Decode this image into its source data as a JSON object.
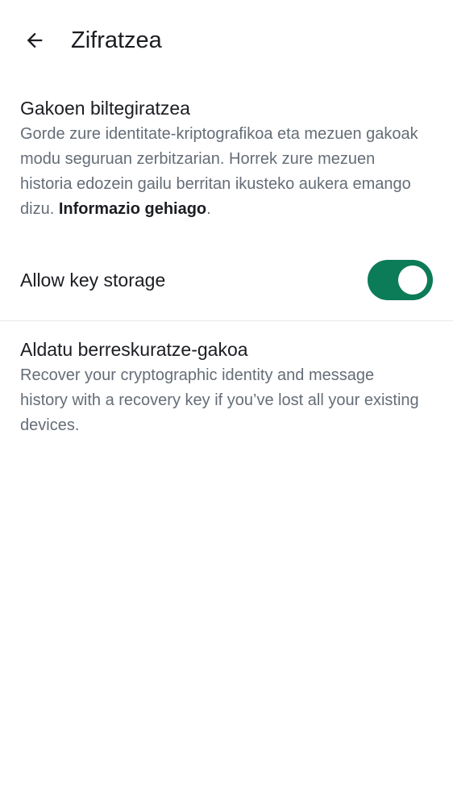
{
  "header": {
    "title": "Zifratzea",
    "back_icon": "arrow-back-icon"
  },
  "key_storage": {
    "title": "Gakoen biltegiratzea",
    "description": "Gorde zure identitate-kriptografikoa eta mezuen gakoak modu seguruan zerbitzarian. Horrek zure mezuen historia edozein gailu berritan ikusteko aukera emango dizu.",
    "link_text": "Informazio gehiago",
    "trailing": ".",
    "toggle_label": "Allow key storage",
    "toggle_on": true,
    "toggle_color": "#0c7b57"
  },
  "recovery": {
    "title": "Aldatu berreskuratze-gakoa",
    "description": "Recover your cryptographic identity and message history with a recovery key if you’ve lost all your existing devices."
  }
}
